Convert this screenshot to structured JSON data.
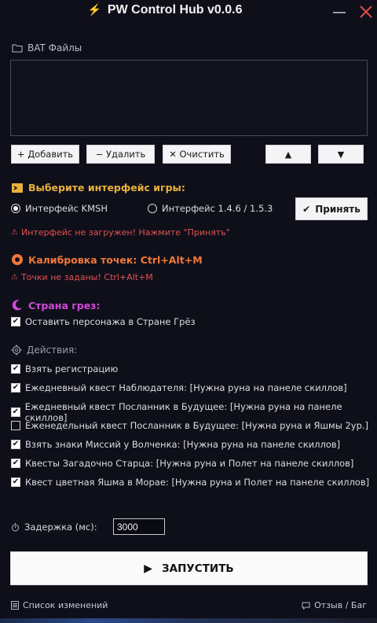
{
  "window": {
    "title": "PW Control Hub  v0.0.6",
    "minimize_icon": "minimize-icon",
    "close_icon": "close-icon",
    "close_color": "#e04848"
  },
  "bat": {
    "label": "BAT Файлы",
    "icon": "folder-icon"
  },
  "toolbar": {
    "add_label": "+ Добавить",
    "remove_label": "− Удалить",
    "clear_label": "✕ Очистить",
    "up_label": "▲",
    "down_label": "▼"
  },
  "interface": {
    "title": "Выберите интерфейс игры:",
    "title_color": "#e8b13a",
    "option_kmsh": "Интерфейс KMSH",
    "option_146": "Интерфейс 1.4.6 / 1.5.3",
    "selected": "Интерфейс KMSH",
    "accept_label": "Принять",
    "warning": "Интерфейс не загружен! Нажмите \"Принять\""
  },
  "calibration": {
    "title": "Калибровка точек:  Ctrl+Alt+M",
    "title_color": "#f07838",
    "warning": "Точки не заданы! Ctrl+Alt+M"
  },
  "dreamland": {
    "title": "Страна грез:",
    "title_color": "#d04ad8",
    "keep_label": "Оставить персонажа в Стране Грёз",
    "keep_checked": true
  },
  "actions": {
    "title": "Действия:",
    "items": [
      {
        "label": "Взять регистрацию",
        "checked": true
      },
      {
        "label": "Ежедневный квест Наблюдателя: [Нужна руна на панеле скиллов]",
        "checked": true
      },
      {
        "label": "Ежедневный квест Посланник в Будущее: [Нужна руна на панеле скиллов]",
        "checked": true
      },
      {
        "label": "Еженедельный квест  Посланник в Будущее: [Нужна руна и Яшмы 2ур.]",
        "checked": false
      },
      {
        "label": "Взять знаки Миссий у Волченка: [Нужна руна на панеле скиллов]",
        "checked": true
      },
      {
        "label": "Квесты Загадочно Старца: [Нужна руна и Полет на панеле скиллов]",
        "checked": true
      },
      {
        "label": "Квест цветная Яшма в Морае: [Нужна руна и Полет на панеле скиллов]",
        "checked": true
      }
    ]
  },
  "delay": {
    "label": "Задержка (мс):",
    "value": "3000"
  },
  "run": {
    "label": "ЗАПУСТИТЬ"
  },
  "footer": {
    "changelog": "Список изменений",
    "feedback": "Отзыв / Баг"
  }
}
